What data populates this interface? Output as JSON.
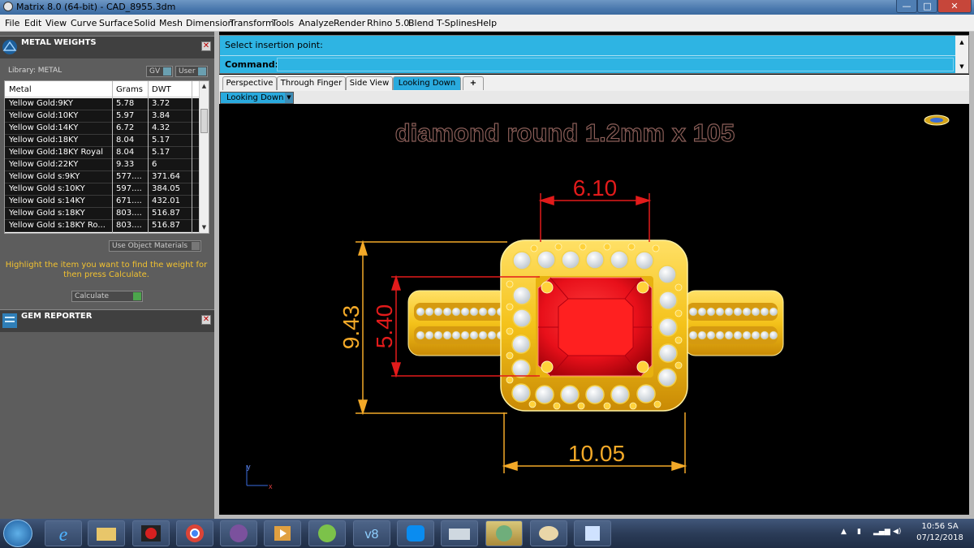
{
  "window": {
    "title": "Matrix 8.0 (64-bit) - CAD_8955.3dm",
    "buttons": {
      "minimize": "—",
      "maximize": "□",
      "close": "✕"
    }
  },
  "menu": [
    "File",
    "Edit",
    "View",
    "Curve",
    "Surface",
    "Solid",
    "Mesh",
    "Dimension",
    "Transform",
    "Tools",
    "Analyze",
    "Render",
    "Rhino 5.0",
    "Blend",
    "T-Splines",
    "Help"
  ],
  "metal_panel": {
    "title": "METAL WEIGHTS",
    "close": "✕",
    "library_label": "Library: METAL",
    "gv_label": "GV",
    "user_label": "User",
    "columns": [
      "Metal",
      "Grams",
      "DWT"
    ],
    "rows": [
      {
        "metal": "Yellow Gold:9KY",
        "grams": "5.78",
        "dwt": "3.72"
      },
      {
        "metal": "Yellow Gold:10KY",
        "grams": "5.97",
        "dwt": "3.84"
      },
      {
        "metal": "Yellow Gold:14KY",
        "grams": "6.72",
        "dwt": "4.32"
      },
      {
        "metal": "Yellow Gold:18KY",
        "grams": "8.04",
        "dwt": "5.17"
      },
      {
        "metal": "Yellow Gold:18KY Royal",
        "grams": "8.04",
        "dwt": "5.17"
      },
      {
        "metal": "Yellow Gold:22KY",
        "grams": "9.33",
        "dwt": "6"
      },
      {
        "metal": "Yellow Gold s:9KY",
        "grams": "577....",
        "dwt": "371.64"
      },
      {
        "metal": "Yellow Gold s:10KY",
        "grams": "597....",
        "dwt": "384.05"
      },
      {
        "metal": "Yellow Gold s:14KY",
        "grams": "671....",
        "dwt": "432.01"
      },
      {
        "metal": "Yellow Gold s:18KY",
        "grams": "803....",
        "dwt": "516.87"
      },
      {
        "metal": "Yellow Gold s:18KY Ro...",
        "grams": "803....",
        "dwt": "516.87"
      }
    ],
    "use_object_materials": "Use Object Materials",
    "hint": "Highlight the item you want to find the weight for then press Calculate.",
    "calculate_label": "Calculate"
  },
  "gem_panel": {
    "title": "GEM REPORTER",
    "close": "✕"
  },
  "command": {
    "prompt": "Select insertion point:",
    "label": "Command:",
    "value": ""
  },
  "tabs": [
    "Perspective",
    "Through Finger",
    "Side View",
    "Looking Down"
  ],
  "active_tab": "Looking Down",
  "add_tab": "+",
  "viewport_selector": "Looking Down",
  "viewport": {
    "heading": "diamond round 1.2mm x 105",
    "dim_top": "6.10",
    "dim_bottom": "10.05",
    "dim_left_outer": "9.43",
    "dim_left_inner": "5.40",
    "axis_y": "y",
    "axis_x": "x",
    "colors": {
      "gold": "#f4c21a",
      "ruby": "#e8101a",
      "dim_red": "#e21b1b",
      "dim_orange": "#f3a928",
      "heading": "#5a3a36"
    }
  },
  "taskbar": {
    "icons": [
      "ie-icon",
      "explorer-icon",
      "garena-icon",
      "chrome-icon",
      "viber-icon",
      "media-player-icon",
      "browser-icon",
      "v8-icon",
      "zalo-icon",
      "scanner-icon",
      "matrix-icon",
      "paint-icon",
      "notes-icon"
    ],
    "time": "10:56 SA",
    "date": "07/12/2018"
  }
}
